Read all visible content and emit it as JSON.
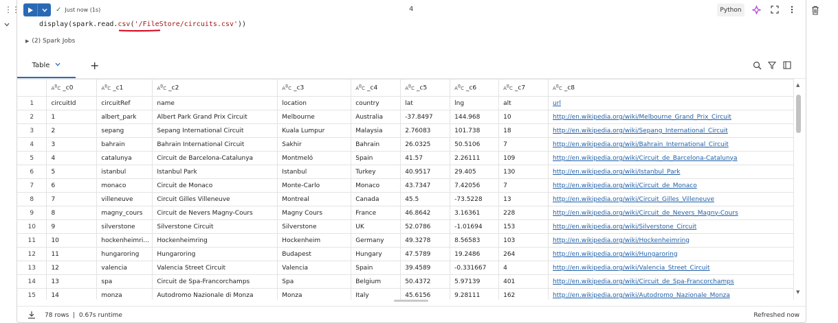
{
  "cell": {
    "status_text": "Just now (1s)",
    "cell_number": "4",
    "language": "Python",
    "code_prefix": "display(spark.read.",
    "code_fn": "csv",
    "code_open": "(",
    "code_string": "'/FileStore/circuits.csv'",
    "code_suffix": "))",
    "spark_jobs": "(2) Spark Jobs"
  },
  "tabs": {
    "active_label": "Table"
  },
  "table": {
    "type_badge": "A",
    "type_badge_sup": "B",
    "type_badge_sub": "C",
    "columns": [
      "_c0",
      "_c1",
      "_c2",
      "_c3",
      "_c4",
      "_c5",
      "_c6",
      "_c7",
      "_c8"
    ],
    "rows": [
      [
        "1",
        "circuitId",
        "circuitRef",
        "name",
        "location",
        "country",
        "lat",
        "lng",
        "alt",
        "url"
      ],
      [
        "2",
        "1",
        "albert_park",
        "Albert Park Grand Prix Circuit",
        "Melbourne",
        "Australia",
        "-37.8497",
        "144.968",
        "10",
        "http://en.wikipedia.org/wiki/Melbourne_Grand_Prix_Circuit"
      ],
      [
        "3",
        "2",
        "sepang",
        "Sepang International Circuit",
        "Kuala Lumpur",
        "Malaysia",
        "2.76083",
        "101.738",
        "18",
        "http://en.wikipedia.org/wiki/Sepang_International_Circuit"
      ],
      [
        "4",
        "3",
        "bahrain",
        "Bahrain International Circuit",
        "Sakhir",
        "Bahrain",
        "26.0325",
        "50.5106",
        "7",
        "http://en.wikipedia.org/wiki/Bahrain_International_Circuit"
      ],
      [
        "5",
        "4",
        "catalunya",
        "Circuit de Barcelona-Catalunya",
        "Montmeló",
        "Spain",
        "41.57",
        "2.26111",
        "109",
        "http://en.wikipedia.org/wiki/Circuit_de_Barcelona-Catalunya"
      ],
      [
        "6",
        "5",
        "istanbul",
        "Istanbul Park",
        "Istanbul",
        "Turkey",
        "40.9517",
        "29.405",
        "130",
        "http://en.wikipedia.org/wiki/Istanbul_Park"
      ],
      [
        "7",
        "6",
        "monaco",
        "Circuit de Monaco",
        "Monte-Carlo",
        "Monaco",
        "43.7347",
        "7.42056",
        "7",
        "http://en.wikipedia.org/wiki/Circuit_de_Monaco"
      ],
      [
        "8",
        "7",
        "villeneuve",
        "Circuit Gilles Villeneuve",
        "Montreal",
        "Canada",
        "45.5",
        "-73.5228",
        "13",
        "http://en.wikipedia.org/wiki/Circuit_Gilles_Villeneuve"
      ],
      [
        "9",
        "8",
        "magny_cours",
        "Circuit de Nevers Magny-Cours",
        "Magny Cours",
        "France",
        "46.8642",
        "3.16361",
        "228",
        "http://en.wikipedia.org/wiki/Circuit_de_Nevers_Magny-Cours"
      ],
      [
        "10",
        "9",
        "silverstone",
        "Silverstone Circuit",
        "Silverstone",
        "UK",
        "52.0786",
        "-1.01694",
        "153",
        "http://en.wikipedia.org/wiki/Silverstone_Circuit"
      ],
      [
        "11",
        "10",
        "hockenheimri...",
        "Hockenheimring",
        "Hockenheim",
        "Germany",
        "49.3278",
        "8.56583",
        "103",
        "http://en.wikipedia.org/wiki/Hockenheimring"
      ],
      [
        "12",
        "11",
        "hungaroring",
        "Hungaroring",
        "Budapest",
        "Hungary",
        "47.5789",
        "19.2486",
        "264",
        "http://en.wikipedia.org/wiki/Hungaroring"
      ],
      [
        "13",
        "12",
        "valencia",
        "Valencia Street Circuit",
        "Valencia",
        "Spain",
        "39.4589",
        "-0.331667",
        "4",
        "http://en.wikipedia.org/wiki/Valencia_Street_Circuit"
      ],
      [
        "14",
        "13",
        "spa",
        "Circuit de Spa-Francorchamps",
        "Spa",
        "Belgium",
        "50.4372",
        "5.97139",
        "401",
        "http://en.wikipedia.org/wiki/Circuit_de_Spa-Francorchamps"
      ],
      [
        "15",
        "14",
        "monza",
        "Autodromo Nazionale di Monza",
        "Monza",
        "Italy",
        "45.6156",
        "9.28111",
        "162",
        "http://en.wikipedia.org/wiki/Autodromo_Nazionale_Monza"
      ]
    ]
  },
  "footer": {
    "rows_label": "78 rows",
    "separator": "|",
    "runtime_label": "0.67s runtime",
    "refreshed_label": "Refreshed now"
  },
  "colors": {
    "accent": "#2a6ab5",
    "link": "#1f5fa8",
    "success": "#2a8a3a",
    "code_string": "#a31515",
    "underline_annotation": "#d0021b"
  },
  "icons": [
    "drag-grip-icon",
    "collapse-chevron-icon",
    "play-icon",
    "chevron-down-icon",
    "check-icon",
    "assistant-sparkle-icon",
    "expand-icon",
    "more-vertical-icon",
    "trash-icon",
    "plus-icon",
    "search-icon",
    "filter-icon",
    "panel-icon",
    "download-icon"
  ]
}
